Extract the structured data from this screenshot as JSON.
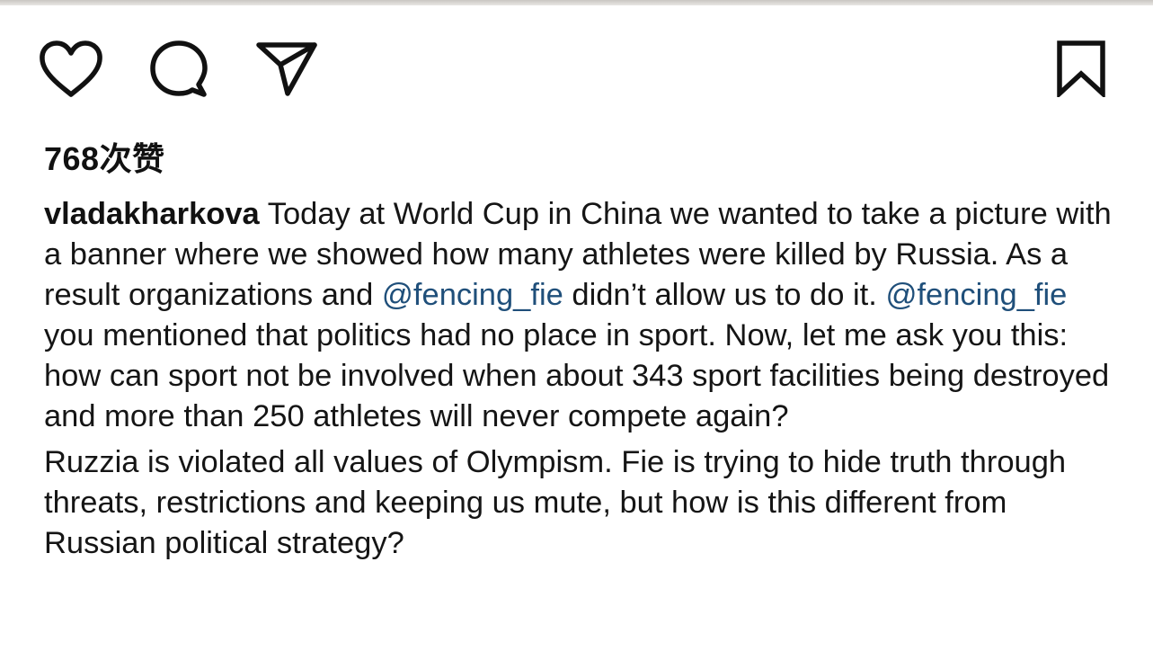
{
  "post": {
    "likes_count": "768",
    "likes_suffix": "次赞",
    "username": "vladakharkova",
    "caption_p1_part1": " Today at World Cup in China we wanted to take a picture with a banner where we showed how many athletes were killed by Russia. As a result organizations and ",
    "mention1": "@fencing_fie",
    "caption_p1_part2": " didn’t allow us to do it. ",
    "mention2": "@fencing_fie",
    "caption_p1_part3": " you mentioned that politics had no place in sport. Now, let me ask you this: how can sport not be involved when about 343 sport facilities being destroyed and more than 250 athletes will never compete again?",
    "caption_p2": "Ruzzia is violated all values of Olympism. Fie is trying to hide truth through threats, restrictions and keeping us mute, but how is this different from Russian political strategy?"
  },
  "icons": {
    "like": "heart-outline",
    "comment": "speech-bubble-outline",
    "share": "paper-plane-outline",
    "save": "bookmark-outline"
  },
  "colors": {
    "text": "#111111",
    "mention": "#1f4f7a",
    "background": "#ffffff"
  }
}
